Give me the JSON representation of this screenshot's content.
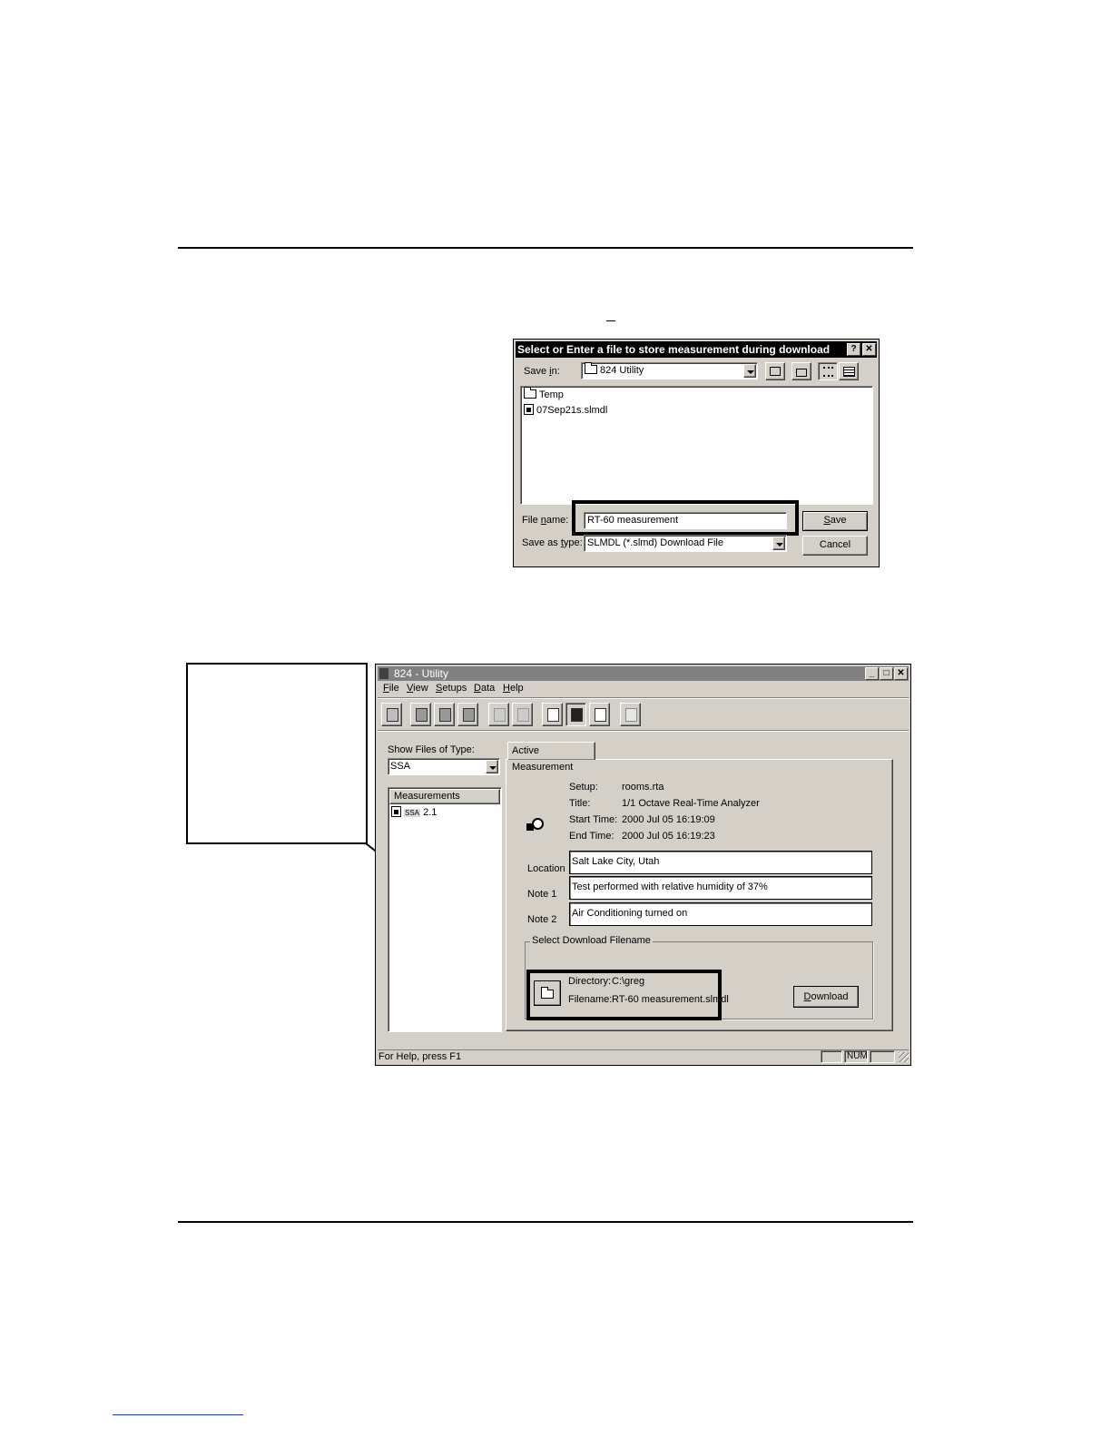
{
  "save_dialog": {
    "title": "Select or Enter a file to store measurement during download",
    "help_btn": "?",
    "close_btn": "✕",
    "save_in_label_pre": "Save ",
    "save_in_label_key": "i",
    "save_in_label_post": "n:",
    "save_in_value": "824 Utility",
    "files": [
      {
        "name": "Temp",
        "icon": "folder-icon"
      },
      {
        "name": "07Sep21s.slmdl",
        "icon": "file-icon"
      }
    ],
    "file_name_label_pre": "File ",
    "file_name_label_key": "n",
    "file_name_label_post": "ame:",
    "file_name_value": "RT-60 measurement",
    "save_type_label_pre": "Save as ",
    "save_type_label_key": "t",
    "save_type_label_post": "ype:",
    "save_type_value": "SLMDL (*.slmd) Download File",
    "save_btn_key": "S",
    "save_btn_rest": "ave",
    "cancel_btn": "Cancel"
  },
  "app": {
    "title": "824 - Utility",
    "menu": [
      {
        "key": "F",
        "rest": "ile"
      },
      {
        "key": "V",
        "rest": "iew"
      },
      {
        "key": "S",
        "rest": "etups"
      },
      {
        "key": "D",
        "rest": "ata"
      },
      {
        "key": "H",
        "rest": "elp"
      }
    ],
    "show_files_label": "Show Files of Type:",
    "show_files_value": "SSA",
    "measurements_header": "Measurements",
    "measurement_item_badge": "SSA",
    "measurement_item": "2.1",
    "tab_label": "Active Measurement",
    "info": {
      "setup_label": "Setup:",
      "setup_value": "rooms.rta",
      "title_label": "Title:",
      "title_value": "1/1 Octave Real-Time Analyzer",
      "start_label": "Start Time:",
      "start_value": "2000 Jul 05 16:19:09",
      "end_label": "End Time:",
      "end_value": "2000 Jul 05 16:19:23"
    },
    "location_label": "Location",
    "location_value": "Salt Lake City, Utah",
    "note1_label": "Note 1",
    "note1_value": "Test performed with relative humidity of 37%",
    "note2_label": "Note 2",
    "note2_value": "Air Conditioning turned on",
    "group_label": "Select Download Filename",
    "directory_label": "Directory:",
    "directory_value": "C:\\greg",
    "filename_label": "Filename:",
    "filename_value": "RT-60 measurement.slmdl",
    "download_key": "D",
    "download_rest": "ownload",
    "status_text": "For Help, press F1",
    "status_num": "NUM"
  }
}
